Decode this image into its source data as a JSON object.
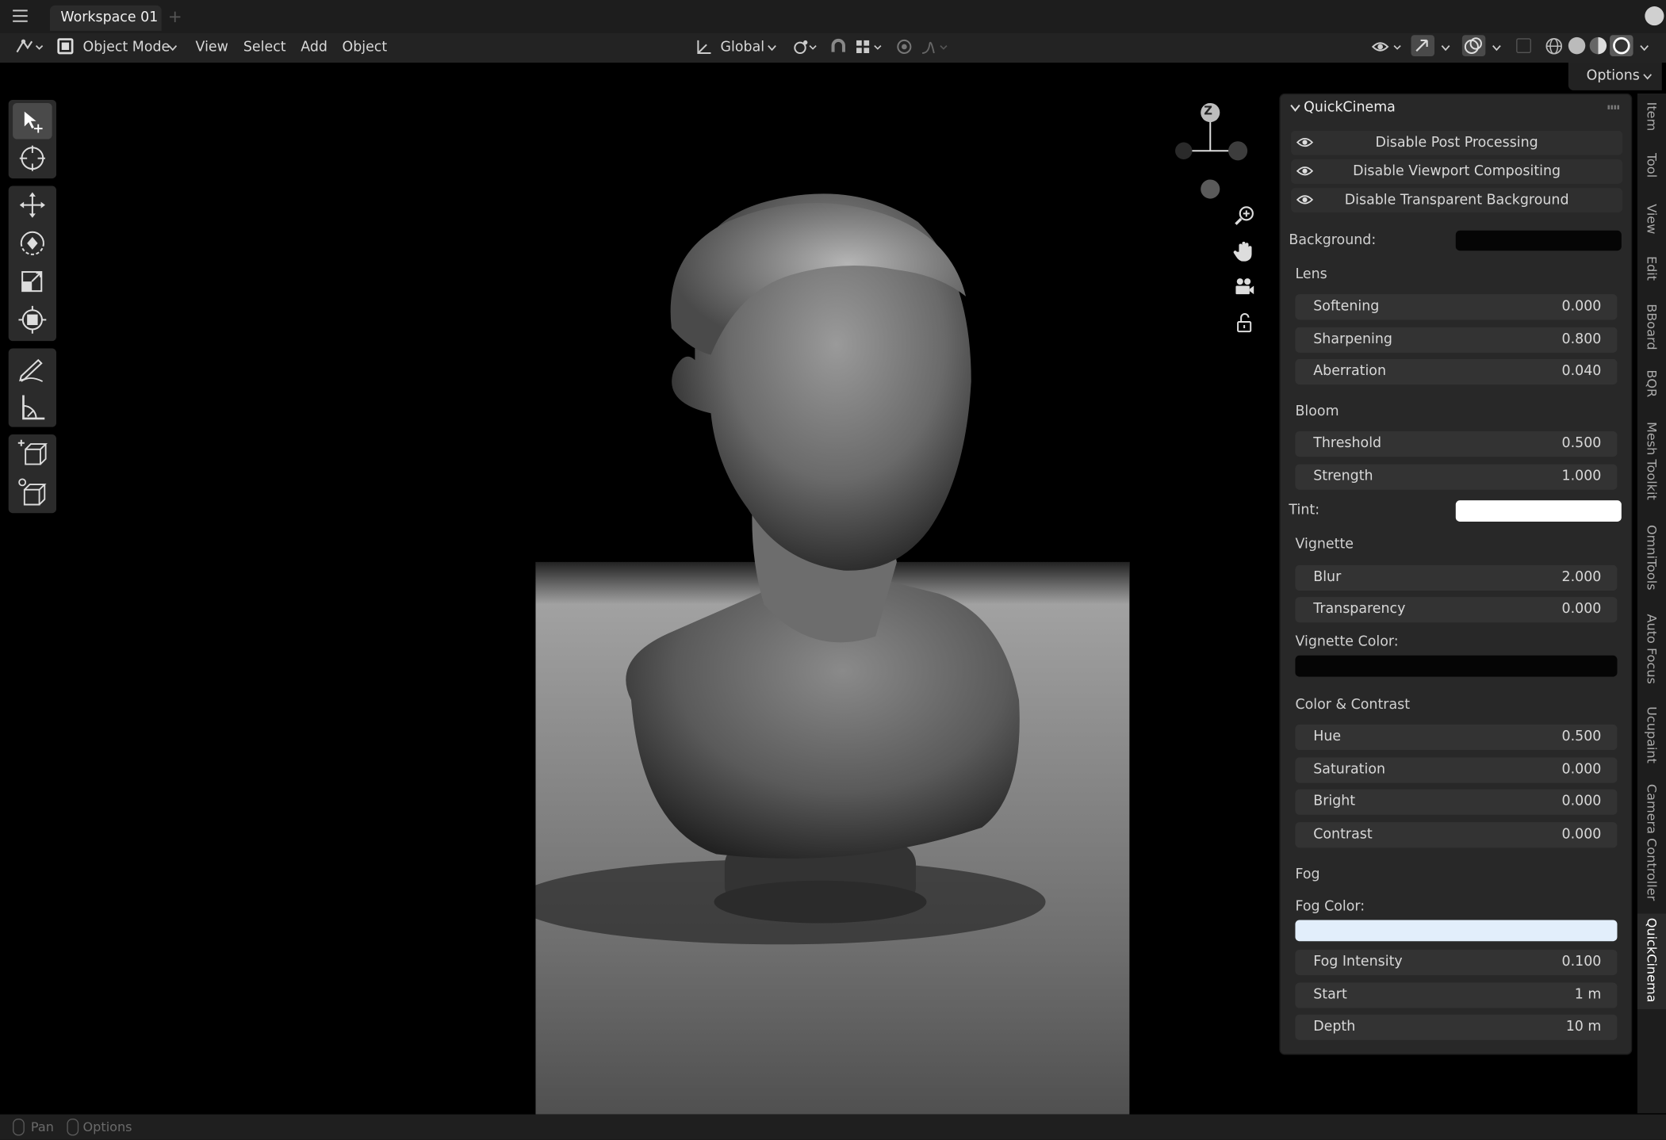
{
  "window": {
    "tab_label": "Workspace 01",
    "add_tab": "+"
  },
  "header": {
    "mode": "Object Mode",
    "menus": [
      "View",
      "Select",
      "Add",
      "Object"
    ],
    "orientation": "Global",
    "options": "Options"
  },
  "gizmo": {
    "axis_label": "Z"
  },
  "panel": {
    "title": "QuickCinema",
    "toggles": [
      "Disable Post Processing",
      "Disable Viewport Compositing",
      "Disable Transparent Background"
    ],
    "background_label": "Background:",
    "background_color": "#050505",
    "lens": {
      "title": "Lens",
      "rows": [
        {
          "label": "Softening",
          "value": "0.000"
        },
        {
          "label": "Sharpening",
          "value": "0.800"
        },
        {
          "label": "Aberration",
          "value": "0.040"
        }
      ]
    },
    "bloom": {
      "title": "Bloom",
      "rows": [
        {
          "label": "Threshold",
          "value": "0.500"
        },
        {
          "label": "Strength",
          "value": "1.000"
        }
      ]
    },
    "tint_label": "Tint:",
    "tint_color": "#ffffff",
    "vignette": {
      "title": "Vignette",
      "rows": [
        {
          "label": "Blur",
          "value": "2.000"
        },
        {
          "label": "Transparency",
          "value": "0.000"
        }
      ],
      "color_label": "Vignette Color:",
      "color": "#050505"
    },
    "color_contrast": {
      "title": "Color & Contrast",
      "rows": [
        {
          "label": "Hue",
          "value": "0.500"
        },
        {
          "label": "Saturation",
          "value": "0.000"
        },
        {
          "label": "Bright",
          "value": "0.000"
        },
        {
          "label": "Contrast",
          "value": "0.000"
        }
      ]
    },
    "fog": {
      "title": "Fog",
      "color_label": "Fog Color:",
      "color": "#e2eefb",
      "rows": [
        {
          "label": "Fog Intensity",
          "value": "0.100"
        },
        {
          "label": "Start",
          "value": "1 m"
        },
        {
          "label": "Depth",
          "value": "10 m"
        }
      ]
    }
  },
  "side_tabs": [
    "Item",
    "Tool",
    "View",
    "Edit",
    "BBoard",
    "BQR",
    "Mesh Toolkit",
    "OmniTools",
    "Auto Focus",
    "Ucupaint",
    "Camera Controller",
    "QuickCinema"
  ],
  "status": {
    "pan": "Pan",
    "options": "Options"
  }
}
